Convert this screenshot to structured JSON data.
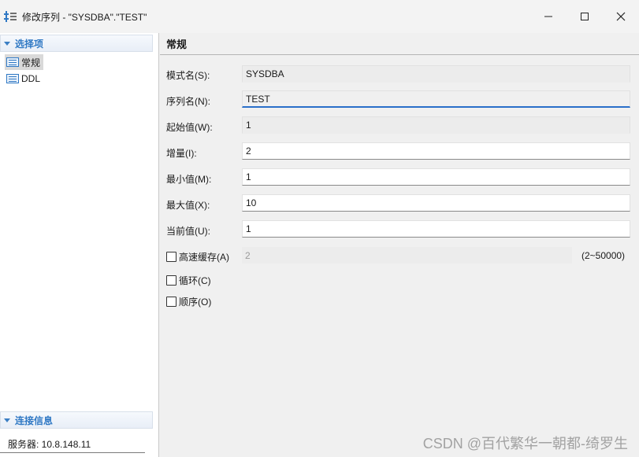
{
  "window": {
    "title": "修改序列 - \"SYSDBA\".\"TEST\"",
    "controls": {
      "minimize": "—",
      "maximize": "☐",
      "close": "✕"
    }
  },
  "left_panel": {
    "section_select": "选择项",
    "items": [
      {
        "label": "常规",
        "selected": true
      },
      {
        "label": "DDL",
        "selected": false
      }
    ],
    "section_connection": "连接信息",
    "server_label": "服务器: 10.8.148.11"
  },
  "right_panel": {
    "title": "常规",
    "fields": [
      {
        "label": "模式名(S):",
        "value": "SYSDBA",
        "state": "readonly"
      },
      {
        "label": "序列名(N):",
        "value": "TEST",
        "state": "focused"
      },
      {
        "label": "起始值(W):",
        "value": "1",
        "state": "readonly"
      },
      {
        "label": "增量(I):",
        "value": "2",
        "state": "editable"
      },
      {
        "label": "最小值(M):",
        "value": "1",
        "state": "editable"
      },
      {
        "label": "最大值(X):",
        "value": "10",
        "state": "editable"
      },
      {
        "label": "当前值(U):",
        "value": "1",
        "state": "editable"
      }
    ],
    "cache": {
      "label": "高速缓存(A)",
      "checked": false,
      "value": "2",
      "range": "(2~50000)"
    },
    "cycle": {
      "label": "循环(C)",
      "checked": false
    },
    "order": {
      "label": "顺序(O)",
      "checked": false
    }
  },
  "watermark": "CSDN @百代繁华一朝都-绮罗生"
}
